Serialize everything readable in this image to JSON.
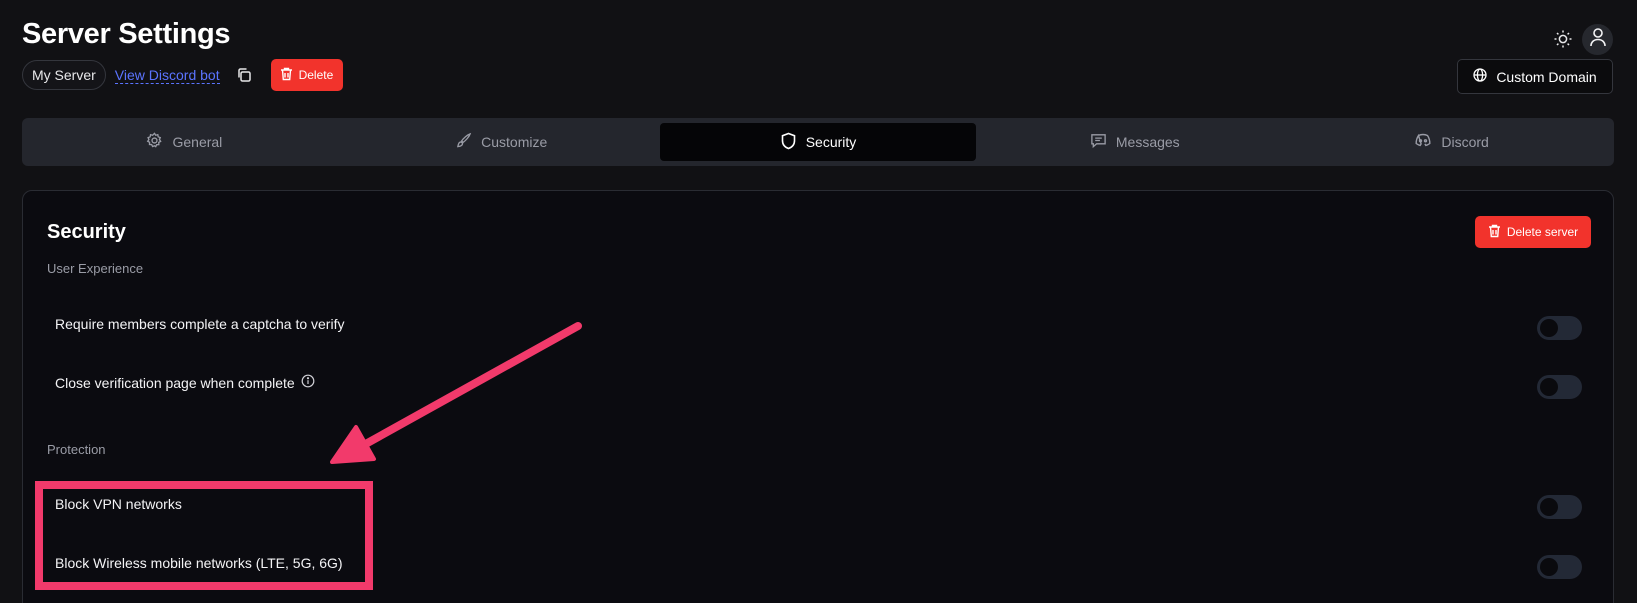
{
  "header": {
    "title": "Server Settings",
    "server_name": "My Server",
    "discord_link": "View Discord bot",
    "delete_label": "Delete",
    "custom_domain_label": "Custom Domain"
  },
  "tabs": [
    {
      "label": "General",
      "icon": "gear-icon",
      "active": false
    },
    {
      "label": "Customize",
      "icon": "brush-icon",
      "active": false
    },
    {
      "label": "Security",
      "icon": "shield-icon",
      "active": true
    },
    {
      "label": "Messages",
      "icon": "message-icon",
      "active": false
    },
    {
      "label": "Discord",
      "icon": "discord-icon",
      "active": false
    }
  ],
  "security": {
    "title": "Security",
    "delete_server_label": "Delete server",
    "sections": [
      {
        "label": "User Experience",
        "settings": [
          {
            "label": "Require members complete a captcha to verify",
            "enabled": false,
            "info": false
          },
          {
            "label": "Close verification page when complete",
            "enabled": false,
            "info": true
          }
        ]
      },
      {
        "label": "Protection",
        "settings": [
          {
            "label": "Block VPN networks",
            "enabled": false,
            "info": false
          },
          {
            "label": "Block Wireless mobile networks (LTE, 5G, 6G)",
            "enabled": false,
            "info": false
          }
        ]
      }
    ]
  },
  "colors": {
    "background": "#111114",
    "card": "#0b0b10",
    "accent_red": "#f2332c",
    "link_blue": "#5b74ff",
    "annotation_pink": "#f23a6b",
    "toggle_off": "#232936"
  }
}
